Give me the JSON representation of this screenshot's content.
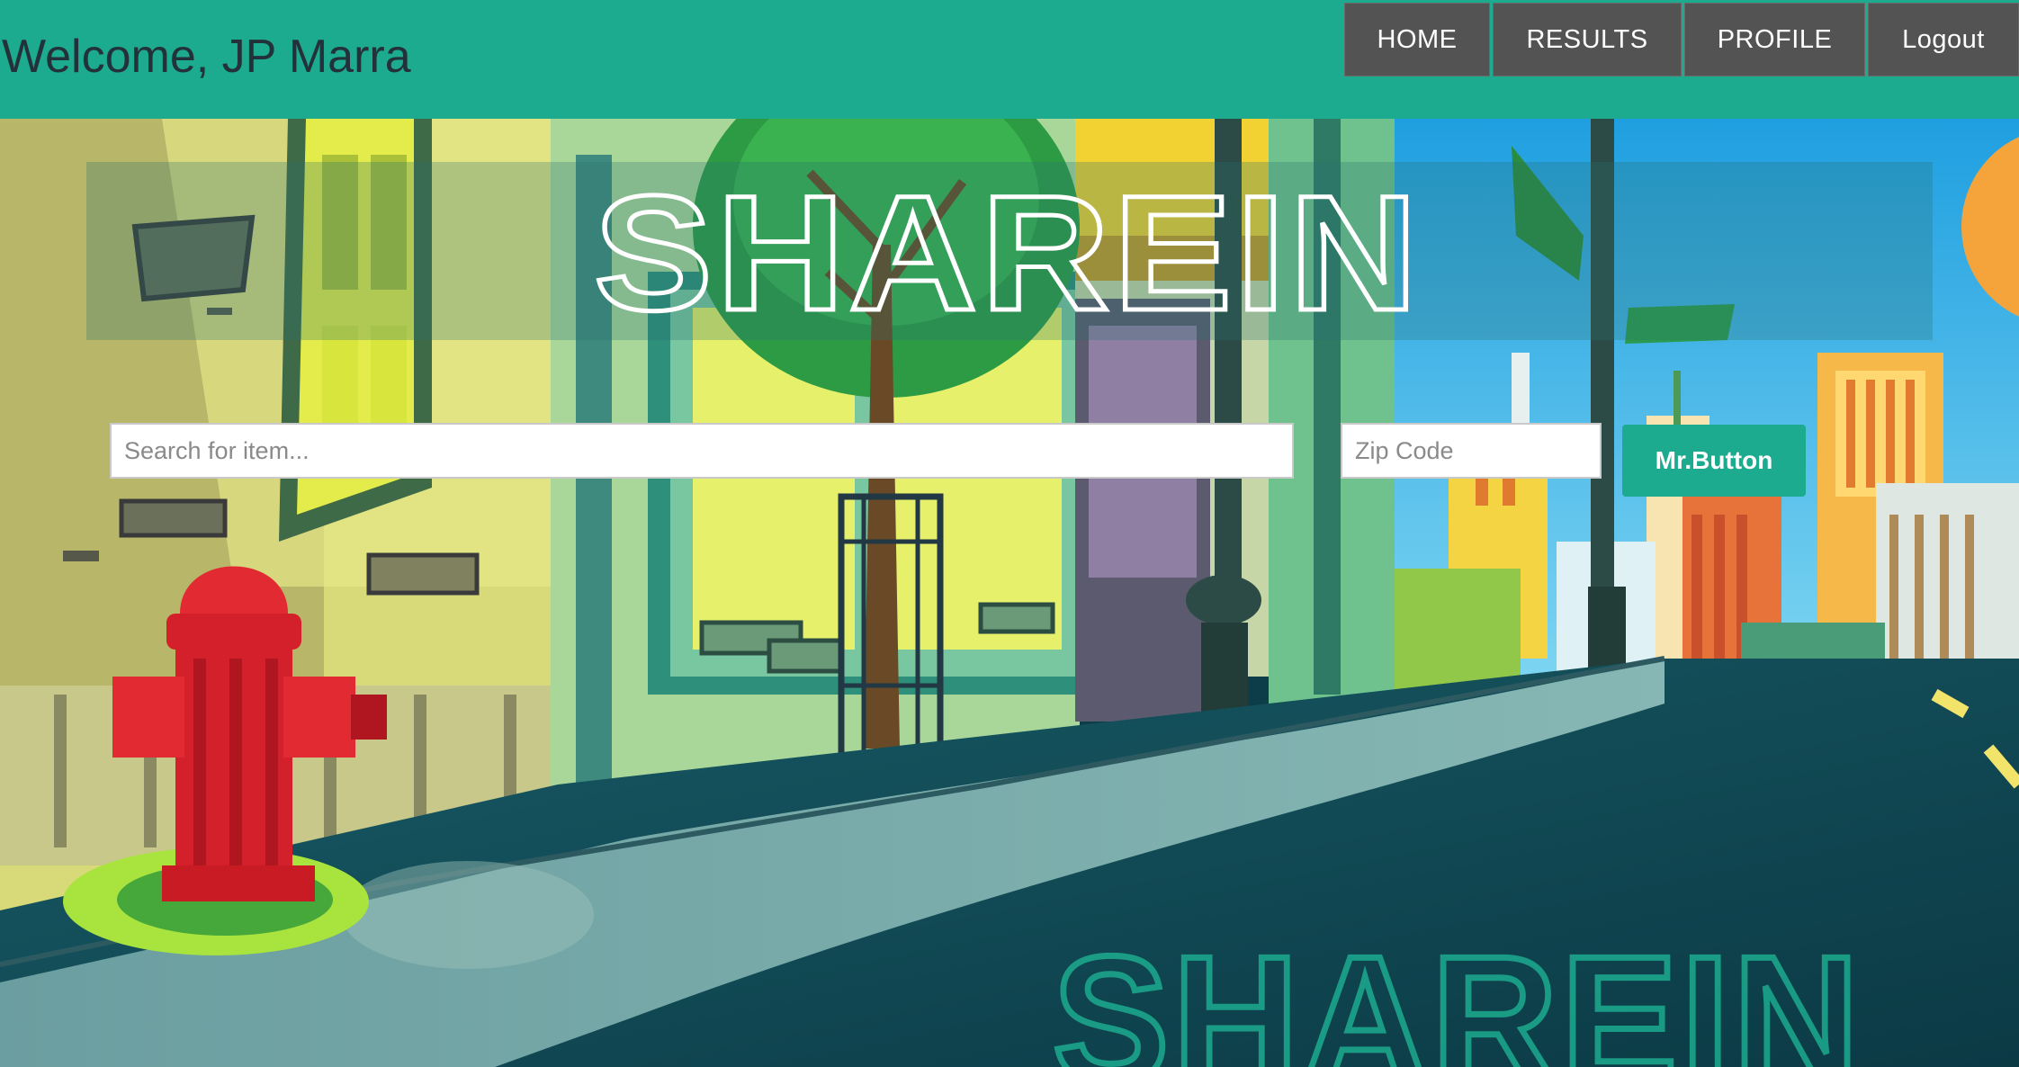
{
  "header": {
    "welcome": "Welcome, JP Marra",
    "nav": [
      {
        "label": "HOME"
      },
      {
        "label": "RESULTS"
      },
      {
        "label": "PROFILE"
      },
      {
        "label": "Logout"
      }
    ]
  },
  "hero": {
    "logo": "SHAREIN",
    "watermark": "SHAREIN",
    "search": {
      "placeholder": "Search for item...",
      "value": ""
    },
    "zip": {
      "placeholder": "Zip Code",
      "value": ""
    },
    "submit_label": "Mr.Button"
  },
  "colors": {
    "brand": "#1cab8f",
    "nav_button": "#535353",
    "welcome_text": "#23323a"
  }
}
